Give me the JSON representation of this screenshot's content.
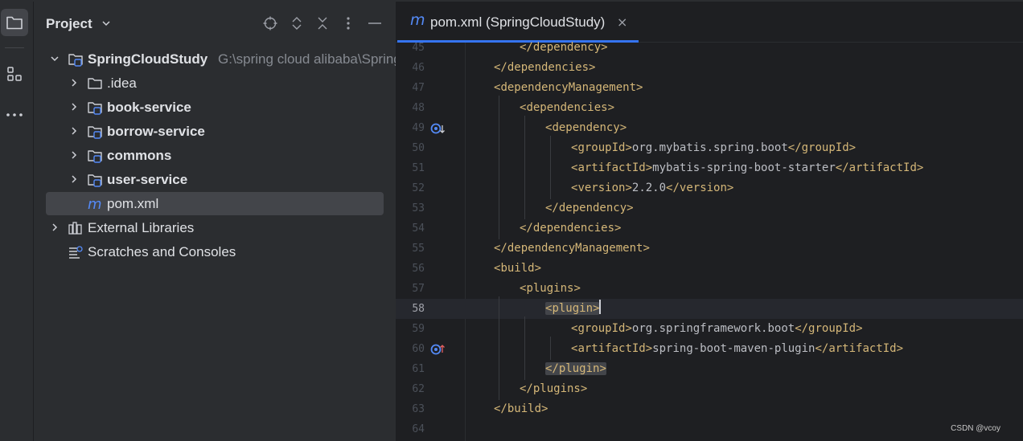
{
  "project_panel": {
    "title": "Project",
    "tree": [
      {
        "label": "SpringCloudStudy",
        "path": "G:\\spring cloud alibaba\\SpringCloudStudy",
        "icon": "module-folder-icon",
        "expanded": true,
        "bold": true
      },
      {
        "label": ".idea",
        "icon": "folder-icon",
        "expanded": false,
        "bold": false
      },
      {
        "label": "book-service",
        "icon": "module-folder-icon",
        "expanded": false,
        "bold": true
      },
      {
        "label": "borrow-service",
        "icon": "module-folder-icon",
        "expanded": false,
        "bold": true
      },
      {
        "label": "commons",
        "icon": "module-folder-icon",
        "expanded": false,
        "bold": true
      },
      {
        "label": "user-service",
        "icon": "module-folder-icon",
        "expanded": false,
        "bold": true
      },
      {
        "label": "pom.xml",
        "icon": "maven-icon",
        "selected": true,
        "bold": false
      },
      {
        "label": "External Libraries",
        "icon": "library-icon",
        "expanded": false,
        "bold": false
      },
      {
        "label": "Scratches and Consoles",
        "icon": "scratches-icon",
        "bold": false
      }
    ]
  },
  "editor": {
    "tab": {
      "icon_letter": "m",
      "label": "pom.xml (SpringCloudStudy)",
      "close": "×"
    },
    "current_line": "58",
    "lines": [
      {
        "n": "45",
        "indent": 2,
        "parts": [
          [
            "brk",
            "</"
          ],
          [
            "tag",
            "dependency"
          ],
          [
            "brk",
            ">"
          ]
        ]
      },
      {
        "n": "46",
        "indent": 1,
        "parts": [
          [
            "brk",
            "</"
          ],
          [
            "tag",
            "dependencies"
          ],
          [
            "brk",
            ">"
          ]
        ]
      },
      {
        "n": "47",
        "indent": 1,
        "parts": [
          [
            "brk",
            "<"
          ],
          [
            "tag",
            "dependencyManagement"
          ],
          [
            "brk",
            ">"
          ]
        ]
      },
      {
        "n": "48",
        "indent": 2,
        "parts": [
          [
            "brk",
            "<"
          ],
          [
            "tag",
            "dependencies"
          ],
          [
            "brk",
            ">"
          ]
        ]
      },
      {
        "n": "49",
        "indent": 3,
        "parts": [
          [
            "brk",
            "<"
          ],
          [
            "tag",
            "dependency"
          ],
          [
            "brk",
            ">"
          ]
        ],
        "gutter": "override-down"
      },
      {
        "n": "50",
        "indent": 4,
        "parts": [
          [
            "brk",
            "<"
          ],
          [
            "tag",
            "groupId"
          ],
          [
            "brk",
            ">"
          ],
          [
            "txt",
            "org.mybatis.spring.boot"
          ],
          [
            "brk",
            "</"
          ],
          [
            "tag",
            "groupId"
          ],
          [
            "brk",
            ">"
          ]
        ]
      },
      {
        "n": "51",
        "indent": 4,
        "parts": [
          [
            "brk",
            "<"
          ],
          [
            "tag",
            "artifactId"
          ],
          [
            "brk",
            ">"
          ],
          [
            "txt",
            "mybatis-spring-boot-starter"
          ],
          [
            "brk",
            "</"
          ],
          [
            "tag",
            "artifactId"
          ],
          [
            "brk",
            ">"
          ]
        ]
      },
      {
        "n": "52",
        "indent": 4,
        "parts": [
          [
            "brk",
            "<"
          ],
          [
            "tag",
            "version"
          ],
          [
            "brk",
            ">"
          ],
          [
            "txt",
            "2.2.0"
          ],
          [
            "brk",
            "</"
          ],
          [
            "tag",
            "version"
          ],
          [
            "brk",
            ">"
          ]
        ]
      },
      {
        "n": "53",
        "indent": 3,
        "parts": [
          [
            "brk",
            "</"
          ],
          [
            "tag",
            "dependency"
          ],
          [
            "brk",
            ">"
          ]
        ]
      },
      {
        "n": "54",
        "indent": 2,
        "parts": [
          [
            "brk",
            "</"
          ],
          [
            "tag",
            "dependencies"
          ],
          [
            "brk",
            ">"
          ]
        ]
      },
      {
        "n": "55",
        "indent": 1,
        "parts": [
          [
            "brk",
            "</"
          ],
          [
            "tag",
            "dependencyManagement"
          ],
          [
            "brk",
            ">"
          ]
        ]
      },
      {
        "n": "56",
        "indent": 1,
        "parts": [
          [
            "brk",
            "<"
          ],
          [
            "tag",
            "build"
          ],
          [
            "brk",
            ">"
          ]
        ]
      },
      {
        "n": "57",
        "indent": 2,
        "parts": [
          [
            "brk",
            "<"
          ],
          [
            "tag",
            "plugins"
          ],
          [
            "brk",
            ">"
          ]
        ]
      },
      {
        "n": "58",
        "indent": 3,
        "parts": [
          [
            "brk",
            "<"
          ],
          [
            "tag",
            "plugin"
          ],
          [
            "brk",
            ">"
          ]
        ],
        "highlight": true,
        "caret": true
      },
      {
        "n": "59",
        "indent": 4,
        "parts": [
          [
            "brk",
            "<"
          ],
          [
            "tag",
            "groupId"
          ],
          [
            "brk",
            ">"
          ],
          [
            "txt",
            "org.springframework.boot"
          ],
          [
            "brk",
            "</"
          ],
          [
            "tag",
            "groupId"
          ],
          [
            "brk",
            ">"
          ]
        ]
      },
      {
        "n": "60",
        "indent": 4,
        "parts": [
          [
            "brk",
            "<"
          ],
          [
            "tag",
            "artifactId"
          ],
          [
            "brk",
            ">"
          ],
          [
            "txt",
            "spring-boot-maven-plugin"
          ],
          [
            "brk",
            "</"
          ],
          [
            "tag",
            "artifactId"
          ],
          [
            "brk",
            ">"
          ]
        ],
        "gutter": "override-up"
      },
      {
        "n": "61",
        "indent": 3,
        "parts": [
          [
            "brk",
            "</"
          ],
          [
            "tag",
            "plugin"
          ],
          [
            "brk",
            ">"
          ]
        ],
        "highlight": true
      },
      {
        "n": "62",
        "indent": 2,
        "parts": [
          [
            "brk",
            "</"
          ],
          [
            "tag",
            "plugins"
          ],
          [
            "brk",
            ">"
          ]
        ]
      },
      {
        "n": "63",
        "indent": 1,
        "parts": [
          [
            "brk",
            "</"
          ],
          [
            "tag",
            "build"
          ],
          [
            "brk",
            ">"
          ]
        ]
      },
      {
        "n": "64",
        "indent": 0,
        "parts": []
      }
    ]
  },
  "watermark": "CSDN @vcoy",
  "colors": {
    "accent": "#3574f0",
    "tag": "#d5b778",
    "text": "#bcbec4",
    "panel_bg": "#2b2d30",
    "editor_bg": "#1e1f22"
  }
}
